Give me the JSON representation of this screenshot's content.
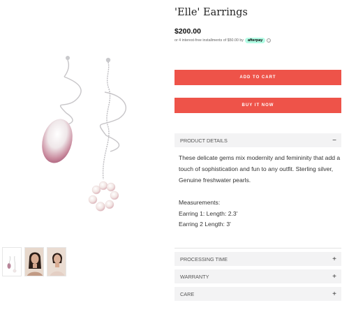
{
  "product": {
    "title": "'Elle' Earrings",
    "price": "$200.00",
    "installments_text": "or 4 interest-free installments of $50.00 by",
    "afterpay_label": "afterpay",
    "info_icon": "i"
  },
  "buttons": {
    "add_to_cart": "ADD TO CART",
    "buy_it_now": "BUY IT NOW"
  },
  "accordion": {
    "details": {
      "label": "PRODUCT DETAILS",
      "sign": "−"
    },
    "processing": {
      "label": "PROCESSING TIME",
      "sign": "+"
    },
    "warranty": {
      "label": "WARRANTY",
      "sign": "+"
    },
    "care": {
      "label": "CARE",
      "sign": "+"
    }
  },
  "details_text": {
    "description": "These delicate gems mix modernity and femininity that add a touch of sophistication and fun to any outfit. Sterling silver, Genuine freshwater pearls.",
    "measurements_heading": "Measurements:",
    "earring_1": "Earring 1: Length: 2.3'",
    "earring_2": "Earring 2 Length:  3'"
  },
  "thumbnails": [
    "earrings-thumb",
    "model-front-thumb",
    "model-side-thumb"
  ],
  "colors": {
    "accent_button": "#ee5349",
    "afterpay_badge": "#b2fce4",
    "accordion_bg": "#f3f3f4"
  }
}
